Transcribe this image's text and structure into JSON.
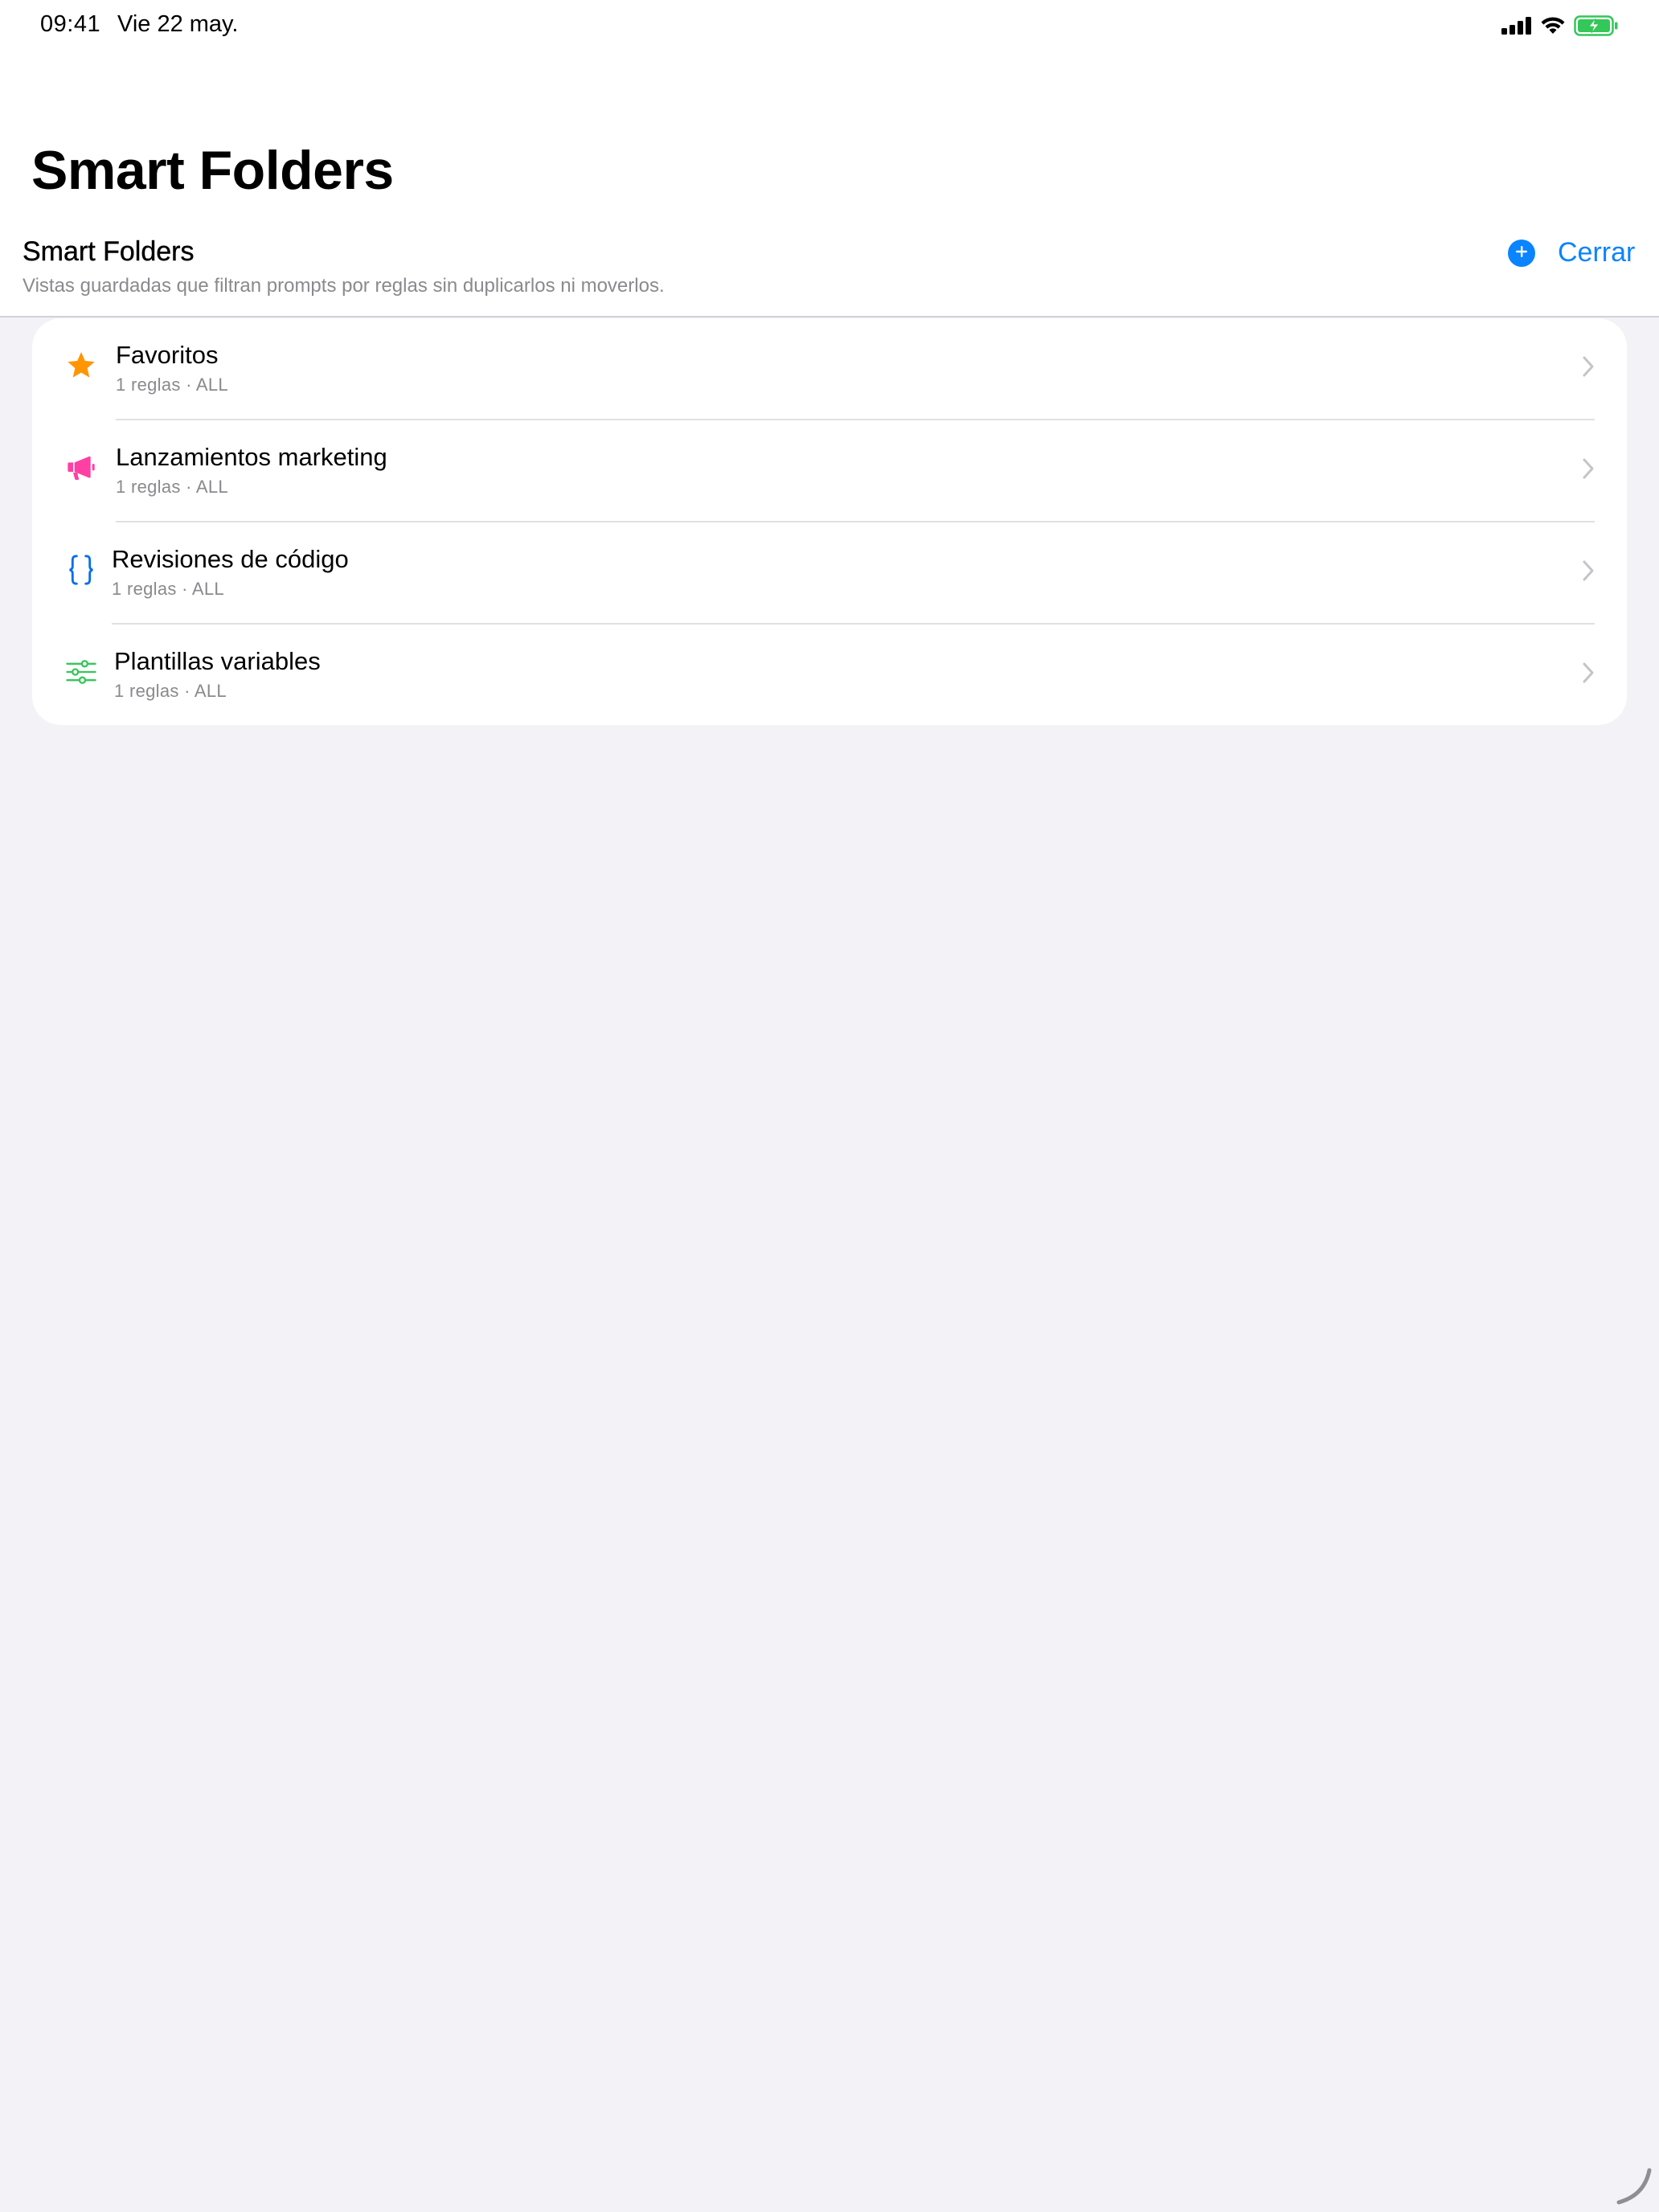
{
  "status_bar": {
    "time": "09:41",
    "date": "Vie 22 may."
  },
  "page": {
    "large_title": "Smart Folders"
  },
  "section": {
    "title": "Smart Folders",
    "subtitle": "Vistas guardadas que filtran prompts por reglas sin duplicarlos ni moverlos.",
    "add_icon": "plus-circle-icon",
    "close_label": "Cerrar"
  },
  "folders": [
    {
      "name": "Favoritos",
      "meta": "1 reglas · ALL",
      "icon": "star-icon",
      "color": "#ff9500"
    },
    {
      "name": "Lanzamientos marketing",
      "meta": "1 reglas · ALL",
      "icon": "megaphone-icon",
      "color": "#ff3fa4"
    },
    {
      "name": "Revisiones de código",
      "meta": "1 reglas · ALL",
      "icon": "curly-braces-icon",
      "color": "#0a6ee8"
    },
    {
      "name": "Plantillas variables",
      "meta": "1 reglas · ALL",
      "icon": "sliders-icon",
      "color": "#34c759"
    }
  ],
  "colors": {
    "accent": "#0a84ff",
    "background": "#f2f2f7",
    "battery": "#34c759"
  }
}
